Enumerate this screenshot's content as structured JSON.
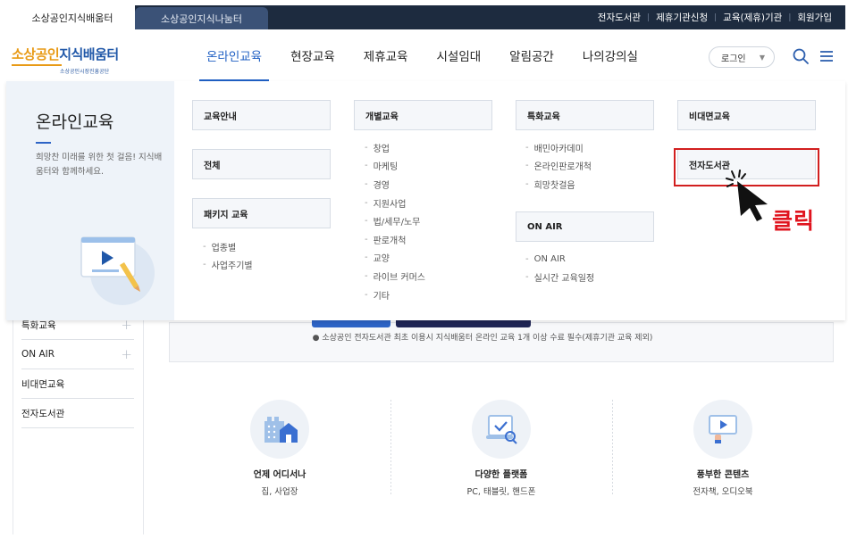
{
  "top_tabs": [
    "소상공인지식배움터",
    "소상공인지식나눔터"
  ],
  "util_links": [
    "전자도서관",
    "제휴기관신청",
    "교육(제휴)기관",
    "회원가입"
  ],
  "logo": {
    "main_a": "소상공인",
    "main_b": "지식배움터",
    "sub": "소상공인시장진흥공단"
  },
  "gnb": [
    "온라인교육",
    "현장교육",
    "제휴교육",
    "시설임대",
    "알림공간",
    "나의강의실"
  ],
  "login_label": "로그인",
  "mega": {
    "title": "온라인교육",
    "desc": "희망찬 미래를 위한 첫 걸음! 지식배움터와 함께하세요.",
    "col1": {
      "box1": "교육안내",
      "box2": "전체",
      "box3": "패키지 교육",
      "items": [
        "업종별",
        "사업주기별"
      ]
    },
    "col2": {
      "box1": "개별교육",
      "items": [
        "창업",
        "마케팅",
        "경영",
        "지원사업",
        "법/세무/노무",
        "판로개척",
        "교양",
        "라이브 커머스",
        "기타"
      ]
    },
    "col3": {
      "box1": "특화교육",
      "items": [
        "배민아카데미",
        "온라인판로개척",
        "희망찻걸음"
      ],
      "box2": "ON AIR",
      "items2": [
        "ON AIR",
        "실시간 교육일정"
      ]
    },
    "col4": {
      "box1": "비대면교육",
      "box2": "전자도서관"
    }
  },
  "annotation": "클릭",
  "sidebar": [
    "특화교육",
    "ON AIR",
    "비대면교육",
    "전자도서관"
  ],
  "notice": "● 소상공인 전자도서관 최초 이용시 지식배움터 온라인 교육 1개 이상 수료 필수(제휴기관 교육 제외)",
  "features": [
    {
      "title": "언제 어디서나",
      "sub": "집, 사업장"
    },
    {
      "title": "다양한 플랫폼",
      "sub": "PC, 태블릿, 핸드폰"
    },
    {
      "title": "풍부한 콘텐츠",
      "sub": "전자책, 오디오북"
    }
  ],
  "colors": {
    "brand_blue": "#1f5fc3",
    "brand_orange": "#e89a16",
    "topbar": "#1d2b3f",
    "highlight_red": "#d21f1f"
  },
  "icons": [
    "search-icon",
    "menu-icon",
    "play-icon",
    "pencil-icon",
    "cursor-icon",
    "plus-icon"
  ]
}
